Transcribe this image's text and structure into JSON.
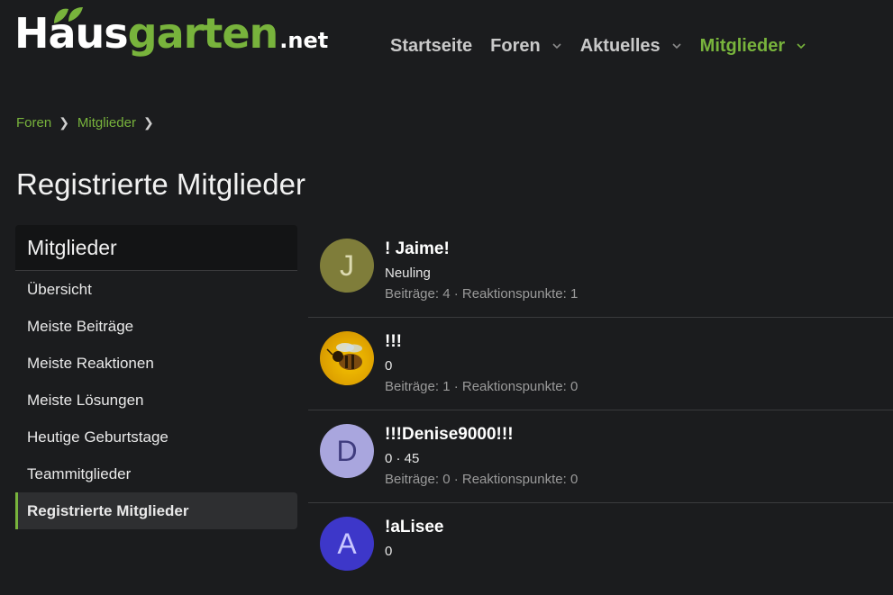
{
  "logo": {
    "part1": "Haus",
    "part2": "garten",
    "part3": ".net"
  },
  "colors": {
    "accent": "#78b33c",
    "background": "#1b1c1e",
    "sidebar_header": "#131415"
  },
  "nav": {
    "items": [
      {
        "label": "Startseite",
        "has_menu": false
      },
      {
        "label": "Foren",
        "has_menu": true
      },
      {
        "label": "Aktuelles",
        "has_menu": true
      },
      {
        "label": "Mitglieder",
        "has_menu": true,
        "active": true
      }
    ]
  },
  "breadcrumb": {
    "items": [
      "Foren",
      "Mitglieder"
    ]
  },
  "page": {
    "title": "Registrierte Mitglieder"
  },
  "sidebar": {
    "heading": "Mitglieder",
    "items": [
      {
        "label": "Übersicht"
      },
      {
        "label": "Meiste Beiträge"
      },
      {
        "label": "Meiste Reaktionen"
      },
      {
        "label": "Meiste Lösungen"
      },
      {
        "label": "Heutige Geburtstage"
      },
      {
        "label": "Teammitglieder"
      },
      {
        "label": "Registrierte Mitglieder",
        "active": true
      }
    ]
  },
  "members": [
    {
      "name": "! Jaime!",
      "title": "Neuling",
      "stats": "Beiträge: 4 · Reaktionspunkte: 1",
      "avatar_letter": "J",
      "avatar_color": "#7f7d3a",
      "avatar_text_color": "#dcdab0"
    },
    {
      "name": "!!!",
      "title": "0",
      "stats": "Beiträge: 1 · Reaktionspunkte: 0",
      "avatar_letter": "",
      "avatar_icon": "bee-photo",
      "avatar_color": "#e6b800"
    },
    {
      "name": "!!!Denise9000!!!",
      "title": "0 · 45",
      "stats": "Beiträge: 0 · Reaktionspunkte: 0",
      "avatar_letter": "D",
      "avatar_color": "#a9a6de",
      "avatar_text_color": "#3f3c7e"
    },
    {
      "name": "!aLisee",
      "title": "0",
      "stats": "",
      "avatar_letter": "A",
      "avatar_color": "#3d37c9",
      "avatar_text_color": "#c8c6ff"
    }
  ]
}
